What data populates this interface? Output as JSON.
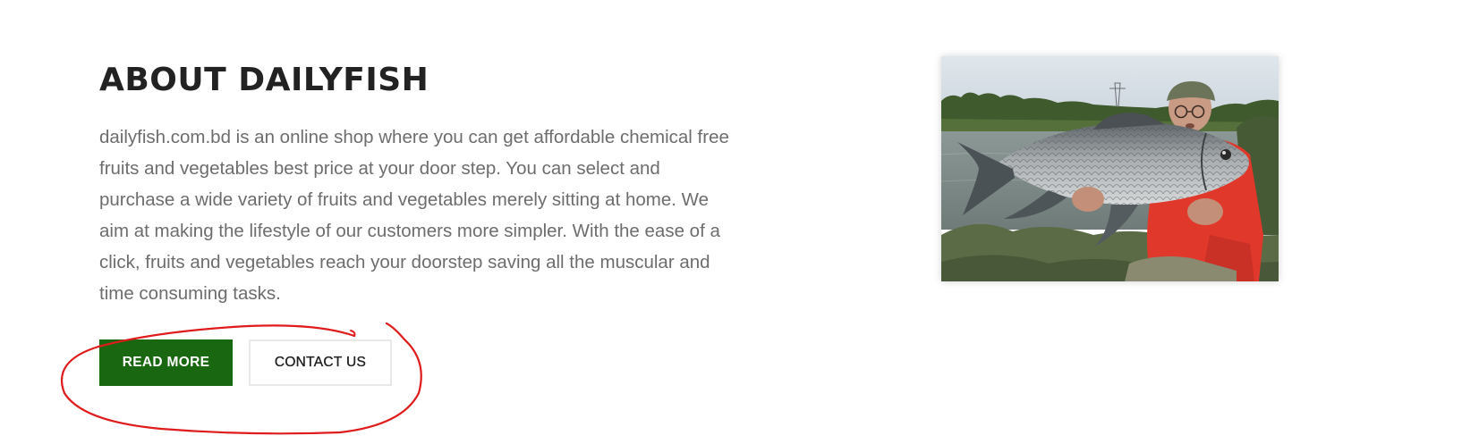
{
  "about": {
    "title": "ABOUT DAILYFISH",
    "description": "dailyfish.com.bd is an online shop where you can get affordable chemical free fruits and vegetables best price at your door step. You can select and purchase a wide variety of fruits and vegetables merely sitting at home. We aim at making the lifestyle of our customers more simpler. With the ease of a click, fruits and vegetables reach your doorstep saving all the muscular and time consuming tasks."
  },
  "buttons": {
    "read_more": "READ MORE",
    "contact_us": "CONTACT US"
  },
  "image": {
    "description": "man holding large fish by a lake"
  },
  "colors": {
    "primary_button": "#1a6711",
    "title_text": "#222222",
    "body_text": "#6d6d6d",
    "annotation_stroke": "#e01b1b"
  },
  "icons": {
    "annotation": "hand-drawn-circle"
  }
}
